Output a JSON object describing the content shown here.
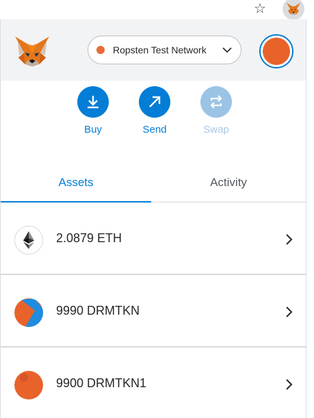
{
  "toolbar": {
    "star_icon": "star-icon",
    "extension_icon": "metamask-fox-icon"
  },
  "header": {
    "network": {
      "label": "Ropsten Test Network",
      "dot_color": "#e96c37"
    },
    "avatar_color": "#e8632a"
  },
  "actions": [
    {
      "label": "Buy",
      "icon": "download-icon",
      "enabled": true
    },
    {
      "label": "Send",
      "icon": "arrow-up-right-icon",
      "enabled": true
    },
    {
      "label": "Swap",
      "icon": "swap-icon",
      "enabled": false
    }
  ],
  "tabs": [
    {
      "label": "Assets",
      "active": true
    },
    {
      "label": "Activity",
      "active": false
    }
  ],
  "assets": [
    {
      "amount": "2.0879 ETH",
      "icon": "ethereum-icon"
    },
    {
      "amount": "9990 DRMTKN",
      "icon": "token-identicon"
    },
    {
      "amount": "9900 DRMTKN1",
      "icon": "token-identicon"
    }
  ],
  "colors": {
    "accent": "#037dd6",
    "accent_disabled": "#9bc3e5",
    "header_bg": "#f2f3f4"
  }
}
